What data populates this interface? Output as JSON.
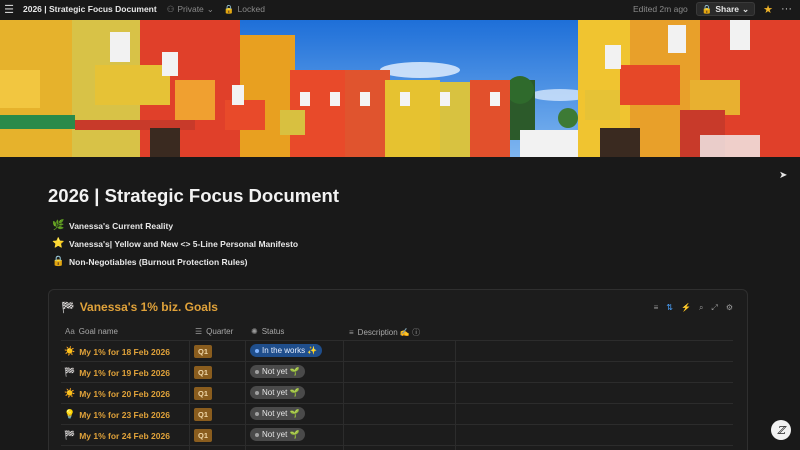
{
  "topbar": {
    "title": "2026 | Strategic Focus Document",
    "privacy": "Private",
    "lock": "Locked",
    "edited": "Edited 2m ago",
    "share": "Share"
  },
  "page": {
    "title": "2026 | Strategic Focus Document",
    "links": [
      {
        "emoji": "🌿",
        "label": "Vanessa's Current Reality"
      },
      {
        "emoji": "⭐",
        "label": "Vanessa's| Yellow and New <> 5-Line Personal Manifesto"
      },
      {
        "emoji": "🔒",
        "label": "Non-Negotiables (Burnout Protection Rules)"
      }
    ]
  },
  "database": {
    "emoji": "🏁",
    "title": "Vanessa's 1% biz. Goals",
    "columns": {
      "name": "Goal name",
      "quarter": "Quarter",
      "status": "Status",
      "description": "Description ✍️ ⓘ"
    },
    "rows": [
      {
        "emoji": "☀️",
        "name": "My 1% for 18 Feb 2026",
        "quarter": "Q1",
        "status": "In the works ✨",
        "status_type": "works"
      },
      {
        "emoji": "🏁",
        "name": "My 1% for 19 Feb 2026",
        "quarter": "Q1",
        "status": "Not yet 🌱",
        "status_type": "notyet"
      },
      {
        "emoji": "☀️",
        "name": "My 1% for 20 Feb 2026",
        "quarter": "Q1",
        "status": "Not yet 🌱",
        "status_type": "notyet"
      },
      {
        "emoji": "💡",
        "name": "My 1% for 23 Feb 2026",
        "quarter": "Q1",
        "status": "Not yet 🌱",
        "status_type": "notyet"
      },
      {
        "emoji": "🏁",
        "name": "My 1% for 24 Feb 2026",
        "quarter": "Q1",
        "status": "Not yet 🌱",
        "status_type": "notyet"
      }
    ]
  },
  "colors": {
    "accent": "#e0a23a",
    "in_the_works": "#1f4e8c",
    "not_yet": "#4a4a4a",
    "quarter_tag": "#8a5d1e"
  }
}
